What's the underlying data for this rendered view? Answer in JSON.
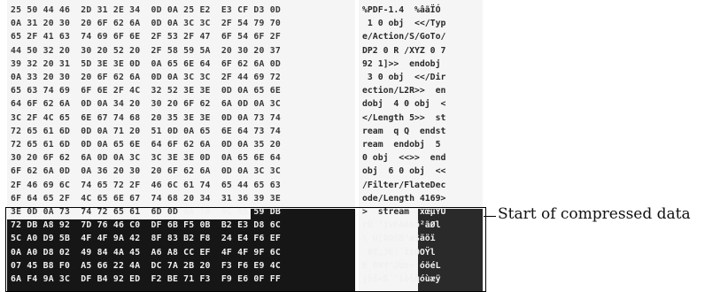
{
  "hex_rows": [
    "25 50 44 46  2D 31 2E 34  0D 0A 25 E2  E3 CF D3 0D",
    "0A 31 20 30  20 6F 62 6A  0D 0A 3C 3C  2F 54 79 70",
    "65 2F 41 63  74 69 6F 6E  2F 53 2F 47  6F 54 6F 2F",
    "44 50 32 20  30 20 52 20  2F 58 59 5A  20 30 20 37",
    "39 32 20 31  5D 3E 3E 0D  0A 65 6E 64  6F 62 6A 0D",
    "0A 33 20 30  20 6F 62 6A  0D 0A 3C 3C  2F 44 69 72",
    "65 63 74 69  6F 6E 2F 4C  32 52 3E 3E  0D 0A 65 6E",
    "64 6F 62 6A  0D 0A 34 20  30 20 6F 62  6A 0D 0A 3C",
    "3C 2F 4C 65  6E 67 74 68  20 35 3E 3E  0D 0A 73 74",
    "72 65 61 6D  0D 0A 71 20  51 0D 0A 65  6E 64 73 74",
    "72 65 61 6D  0D 0A 65 6E  64 6F 62 6A  0D 0A 35 20",
    "30 20 6F 62  6A 0D 0A 3C  3C 3E 3E 0D  0A 65 6E 64",
    "6F 62 6A 0D  0A 36 20 30  20 6F 62 6A  0D 0A 3C 3C",
    "2F 46 69 6C  74 65 72 2F  46 6C 61 74  65 44 65 63",
    "6F 64 65 2F  4C 65 6E 67  74 68 20 34  31 36 39 3E",
    "3E 0D 0A 73  74 72 65 61  6D 0D 0A 78  9C B5 59 DB",
    "72 DB A8 92  7D 76 46 C0  DF 6B F5 0B  B2 E3 D8 6C",
    "5C A0 D9 5B  4F 4F 9A 42  8F 83 B2 F8  24 E4 F6 EF",
    "0A A0 D8 02  49 84 4A 45  A6 A8 CC EF  4F 4F 9F 6C",
    "07 45 B8 F0  A5 66 22 4A  DC 7A 2B 20  F3 F6 E9 4C",
    "6A F4 9A 3C  DF B4 92 ED  F2 BE 71 F3  F9 E6 0F FF"
  ],
  "ascii_rows": [
    "%PDF-1.4  %âãÏÓ",
    " 1 0 obj  <</Typ",
    "e/Action/S/GoTo/",
    "DP2 0 R /XYZ 0 7",
    "92 1]>>  endobj",
    " 3 0 obj  <</Dir",
    "ection/L2R>>  en",
    "dobj  4 0 obj  <",
    "</Length 5>>  st",
    "ream  q Q  endst",
    "ream  endobj  5 ",
    "0 obj  <<>>  end",
    "obj  6 0 obj  <<",
    "/Filter/FlateDec",
    "ode/Length 4169>",
    ">  stream  xœµYÛ",
    "rÛ¨’}vFÀßkõ²ãØl",
    "\\ Ù[OOšB²ø$äöï",
    " ØI„JE¦¨ÌïOOŸl",
    "E¸ð¥f\"JÜz+ óöéL",
    "jôš<ß´’íò¾qóùæÿ"
  ],
  "annotation": {
    "label": "Start of compressed data"
  }
}
